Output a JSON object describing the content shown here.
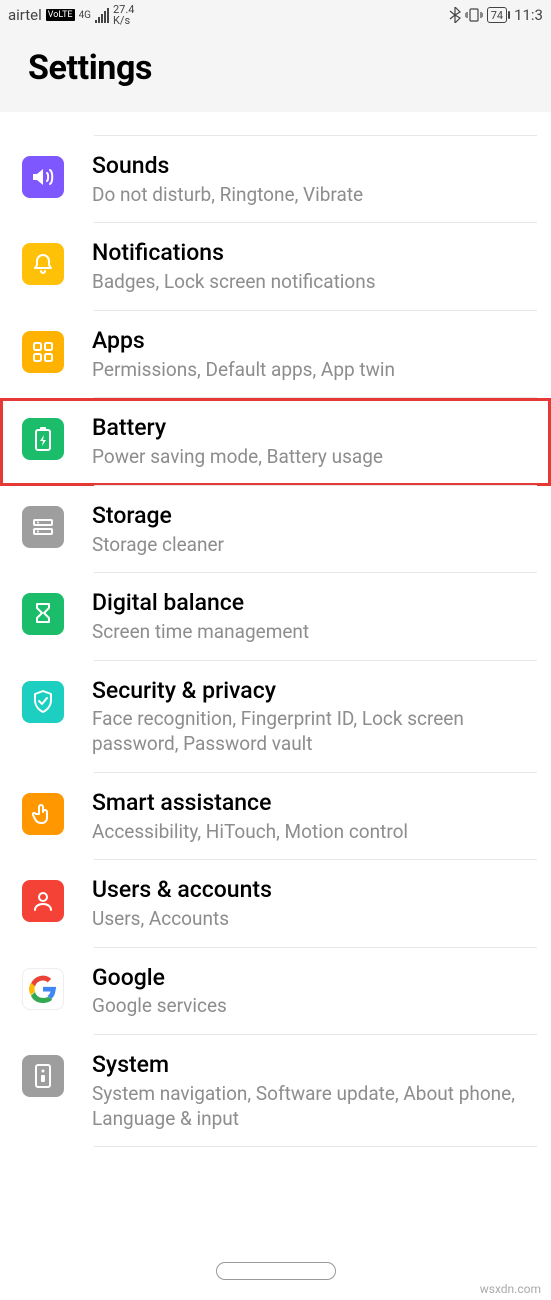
{
  "statusBar": {
    "carrier": "airtel",
    "volte": "VoLTE",
    "network": "4G",
    "speed": "27.4",
    "speedUnit": "K/s",
    "battery": "74",
    "time": "11:3"
  },
  "header": {
    "title": "Settings"
  },
  "items": {
    "sounds": {
      "title": "Sounds",
      "sub": "Do not disturb, Ringtone, Vibrate"
    },
    "notifications": {
      "title": "Notifications",
      "sub": "Badges, Lock screen notifications"
    },
    "apps": {
      "title": "Apps",
      "sub": "Permissions, Default apps, App twin"
    },
    "battery": {
      "title": "Battery",
      "sub": "Power saving mode, Battery usage"
    },
    "storage": {
      "title": "Storage",
      "sub": "Storage cleaner"
    },
    "balance": {
      "title": "Digital balance",
      "sub": "Screen time management"
    },
    "security": {
      "title": "Security & privacy",
      "sub": "Face recognition, Fingerprint ID, Lock screen password, Password vault"
    },
    "smart": {
      "title": "Smart assistance",
      "sub": "Accessibility, HiTouch, Motion control"
    },
    "users": {
      "title": "Users & accounts",
      "sub": "Users, Accounts"
    },
    "google": {
      "title": "Google",
      "sub": "Google services"
    },
    "system": {
      "title": "System",
      "sub": "System navigation, Software update, About phone, Language & input"
    }
  },
  "watermark": "wsxdn.com"
}
